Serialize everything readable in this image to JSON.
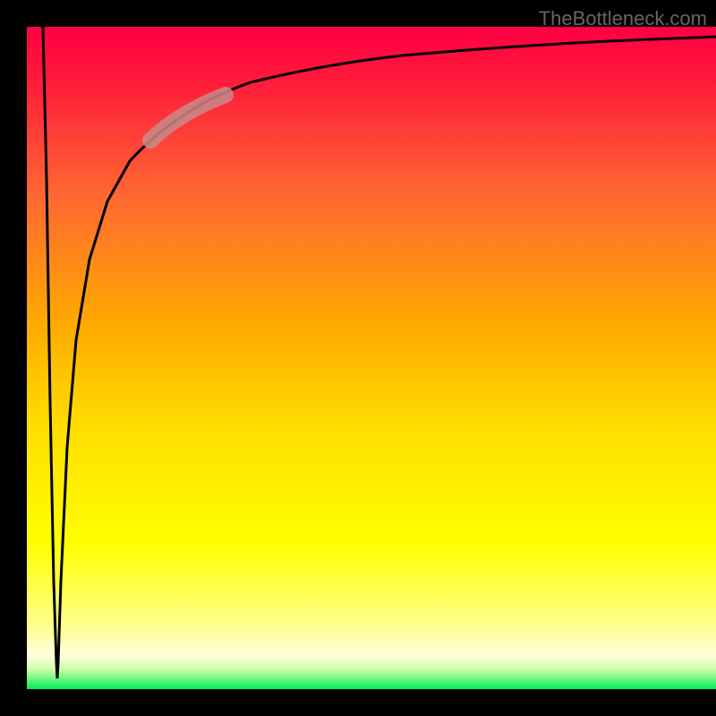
{
  "watermark": "TheBottleneck.com",
  "chart_data": {
    "type": "line",
    "title": "",
    "xlabel": "",
    "ylabel": "",
    "xlim": [
      0,
      100
    ],
    "ylim": [
      0,
      100
    ],
    "background": {
      "type": "gradient",
      "stops": [
        {
          "offset": 0,
          "color": "#ff0033"
        },
        {
          "offset": 0.25,
          "color": "#ff6633"
        },
        {
          "offset": 0.5,
          "color": "#ffcc00"
        },
        {
          "offset": 0.75,
          "color": "#ffff33"
        },
        {
          "offset": 0.96,
          "color": "#ffff99"
        },
        {
          "offset": 1.0,
          "color": "#00ff66"
        }
      ]
    },
    "series": [
      {
        "name": "curve",
        "description": "V-shaped curve: sharp drop near x=0 then logarithmic rise to top",
        "points": [
          {
            "x": 2.5,
            "y": 99
          },
          {
            "x": 3.5,
            "y": 50
          },
          {
            "x": 4.2,
            "y": 10
          },
          {
            "x": 4.5,
            "y": 2
          },
          {
            "x": 4.8,
            "y": 10
          },
          {
            "x": 6,
            "y": 40
          },
          {
            "x": 8,
            "y": 60
          },
          {
            "x": 12,
            "y": 75
          },
          {
            "x": 18,
            "y": 84
          },
          {
            "x": 25,
            "y": 88
          },
          {
            "x": 35,
            "y": 91
          },
          {
            "x": 50,
            "y": 93.5
          },
          {
            "x": 70,
            "y": 95.5
          },
          {
            "x": 100,
            "y": 97
          }
        ]
      }
    ],
    "highlight": {
      "description": "pink rounded segment on curve",
      "x_range": [
        18,
        30
      ],
      "y_range": [
        84,
        89
      ],
      "color": "#cc8a8a"
    },
    "frame": {
      "left_bar_width": 30,
      "bottom_bar_height": 30,
      "color": "#000000"
    }
  }
}
